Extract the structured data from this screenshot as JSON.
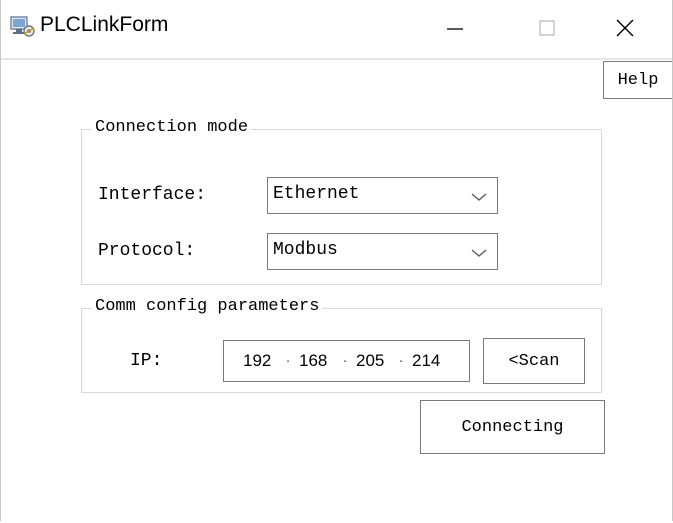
{
  "window": {
    "title": "PLCLinkForm",
    "icon": "plc-app-icon",
    "controls": [
      "minimize-icon",
      "maximize-icon",
      "close-icon"
    ]
  },
  "help_label": "Help",
  "connection_mode": {
    "title": "Connection mode",
    "interface_label": "Interface:",
    "interface_value": "Ethernet",
    "protocol_label": "Protocol:",
    "protocol_value": "Modbus"
  },
  "comm_config": {
    "title": "Comm config parameters",
    "ip_label": "IP:",
    "ip_octets": [
      "192",
      "168",
      "205",
      "214"
    ],
    "scan_label": "<Scan"
  },
  "connect_label": "Connecting",
  "colors": {
    "border": "#7a7a7a",
    "group_border": "#d9d9d9",
    "background": "#ffffff"
  }
}
